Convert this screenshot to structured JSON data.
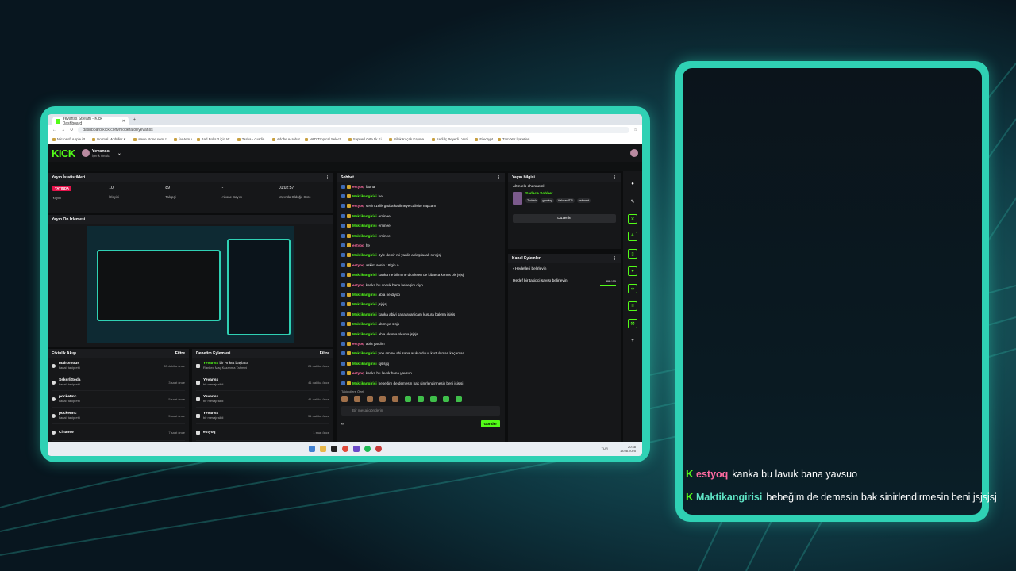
{
  "browser": {
    "tab_title": "Yevanss Stream - Kick Dashboard",
    "url": "dashboard.kick.com/moderator/yevanss",
    "bookmarks": [
      "Microsoft Apple iP...",
      "Normal Modüller K...",
      "steve stone semi t...",
      "fer-temu",
      "Bad Bolts 3 için W...",
      "Tasha - cuadin...",
      "Adobe Acrobat",
      "N&D Tropical Select...",
      "Sapwell Orta tik Ki...",
      "Silek Kaçak Kayma...",
      "Kedi İç Beyedi | Veti...",
      "Filecrypt",
      "Tüm Yer İşaretleri"
    ]
  },
  "kick": {
    "logo": "KICK",
    "user": {
      "name": "Yevanss",
      "role": "İçerik Üretici"
    }
  },
  "stats": {
    "header": "Yayın İstatistikleri",
    "live_badge": "YAYINDA",
    "items": [
      {
        "value": "",
        "label": "Yayın"
      },
      {
        "value": "10",
        "label": "İzleyici"
      },
      {
        "value": "89",
        "label": "Takipçi"
      },
      {
        "value": "-",
        "label": "Abone Sayısı"
      },
      {
        "value": "01:02:57",
        "label": "Yayında Olduğu Süre"
      }
    ]
  },
  "preview": {
    "header": "Yayın Ön İzlemesi"
  },
  "activity": {
    "header": "Etkinlik Akışı",
    "filter": "Filtre",
    "items": [
      {
        "name": "mairomous",
        "sub": "kanalı takip etti",
        "time": "30 dakika önce"
      },
      {
        "name": "SekerliSoda",
        "sub": "kanalı takip etti",
        "time": "3 saat önce"
      },
      {
        "name": "pocketmc",
        "sub": "kanalı takip etti",
        "time": "5 saat önce"
      },
      {
        "name": "pocketmc",
        "sub": "kanalı takip etti",
        "time": "5 saat önce"
      },
      {
        "name": "Cihan69",
        "sub": "",
        "time": "7 saat önce"
      }
    ]
  },
  "moderation": {
    "header": "Denetim Eylemleri",
    "filter": "Filtre",
    "items": [
      {
        "name": "Yevanss",
        "action": " bir Anket başlattı",
        "sub": "Ranked Maç Kazanma Tahmini",
        "time": "24 dakika önce"
      },
      {
        "name": "Yevanss",
        "action": "",
        "sub": "bir mesajı sildi",
        "time": "41 dakika önce"
      },
      {
        "name": "Yevanss",
        "action": "",
        "sub": "bir mesajı sildi",
        "time": "41 dakika önce"
      },
      {
        "name": "Yevanss",
        "action": "",
        "sub": "bir mesajı sildi",
        "time": "51 dakika önce"
      },
      {
        "name": "estyoq",
        "action": "",
        "sub": "",
        "time": "1 saat önce"
      }
    ]
  },
  "chat": {
    "header": "Sohbet",
    "messages": [
      {
        "user": "estyoq",
        "color": "p",
        "text": "fatma"
      },
      {
        "user": "Maktikangirisi",
        "color": "g",
        "text": "he"
      },
      {
        "user": "estyoq",
        "color": "p",
        "text": "senin 18lik gruba katilmeye calisito napcam"
      },
      {
        "user": "Maktikangirisi",
        "color": "g",
        "text": "eminee"
      },
      {
        "user": "Maktikangirisi",
        "color": "g",
        "text": "eminee"
      },
      {
        "user": "Maktikangirisi",
        "color": "g",
        "text": "eminee"
      },
      {
        "user": "estyoq",
        "color": "p",
        "text": "he"
      },
      {
        "user": "Maktikangirisi",
        "color": "g",
        "text": "öyle demir mi yanlis anlaşılacak sırışjsj"
      },
      {
        "user": "estyoq",
        "color": "p",
        "text": "askim senin 18lgin o"
      },
      {
        "user": "Maktikangirisi",
        "color": "g",
        "text": "kanka ne bilim ne diceksen de kibarca konus pls jsjsj"
      },
      {
        "user": "estyoq",
        "color": "p",
        "text": "kanka bu cocuk bana bebegim diyo"
      },
      {
        "user": "Maktikangirisi",
        "color": "g",
        "text": "abla ne diyoo"
      },
      {
        "user": "Maktikangirisi",
        "color": "g",
        "text": "jsjsjsj"
      },
      {
        "user": "Maktikangirisi",
        "color": "g",
        "text": "kanka abiyi sana ayarlicam kusura bakma jsjsjs"
      },
      {
        "user": "Maktikangirisi",
        "color": "g",
        "text": "abim ya sjsjs"
      },
      {
        "user": "Maktikangirisi",
        "color": "g",
        "text": "abla okuma okuma jsjsjs"
      },
      {
        "user": "estyoq",
        "color": "p",
        "text": "abla yardim"
      },
      {
        "user": "Maktikangirisi",
        "color": "g",
        "text": "yoo amine abi sana aşık olduuu kurtulaman kaçaman"
      },
      {
        "user": "Maktikangirisi",
        "color": "g",
        "text": "sjsjsjsj"
      },
      {
        "user": "estyoq",
        "color": "p",
        "text": "kanka bu lavuk bana yavsuo"
      },
      {
        "user": "Maktikangirisi",
        "color": "g",
        "text": "bebeğim de demesin bak sinirlendirmesin beni jsjsjsj"
      }
    ],
    "emote_label": "Takipçilere Özel",
    "input_placeholder": "Bir mesaj gönderin",
    "infinity": "∞",
    "send": "Gönder"
  },
  "stream_info": {
    "header": "Yayın bilgisi",
    "title": "Altın elo chenneml",
    "category": "Sadece Sohbet",
    "tags": [
      "Turkish",
      "gaming",
      "ValorantTR",
      "valorant"
    ],
    "edit": "Düzenle"
  },
  "channel_actions": {
    "header": "Kanal Eylemleri",
    "back": "Hedefleri belirleyin",
    "goal_label": "Hedef bir takipçi sayısı belirleyin",
    "goal_value": "89 / 90",
    "goal_fraction": 0.99
  },
  "taskbar": {
    "lang": "TUR",
    "time": "20:48",
    "date": "18.08.2025"
  },
  "overlay_chat": [
    {
      "user": "estyoq",
      "color": "#ff6aa0",
      "text": "kanka bu lavuk bana yavsuo"
    },
    {
      "user": "Maktikangirisi",
      "color": "#5ee4c4",
      "text": "bebeğim de demesin bak sinirlendirmesin beni jsjsjsj"
    }
  ]
}
